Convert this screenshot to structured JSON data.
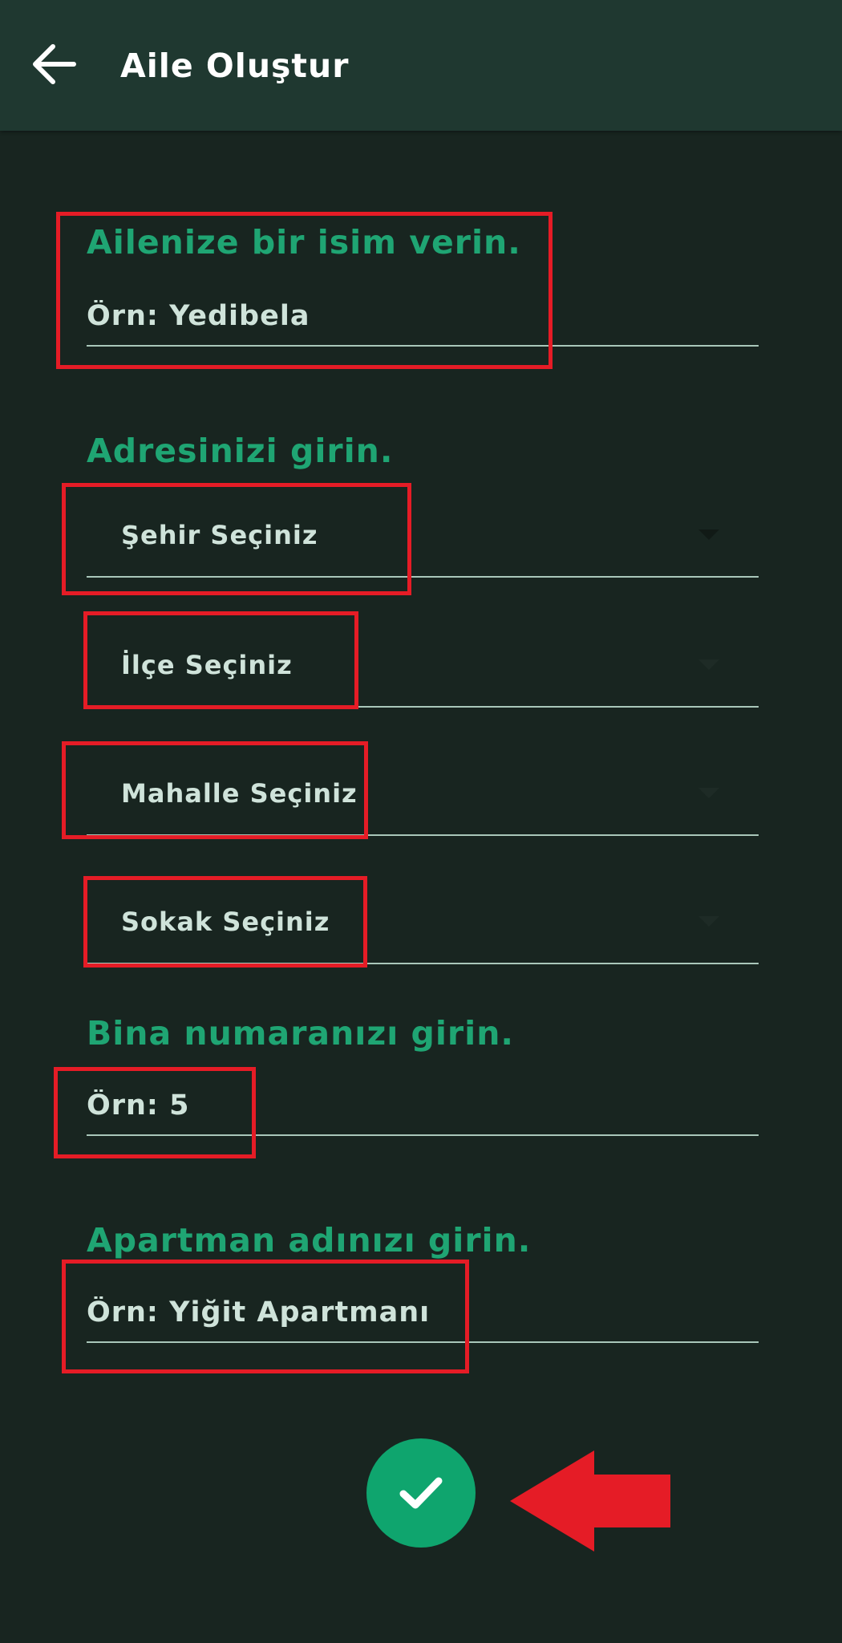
{
  "appbar": {
    "title": "Aile Oluştur"
  },
  "family_name": {
    "label": "Ailenize bir isim verin.",
    "placeholder": "Örn: Yedibela"
  },
  "address": {
    "label": "Adresinizi girin.",
    "city_select": "Şehir Seçiniz",
    "district_select": "İlçe Seçiniz",
    "neighborhood_select": "Mahalle Seçiniz",
    "street_select": "Sokak Seçiniz"
  },
  "building": {
    "label": "Bina numaranızı girin.",
    "placeholder": "Örn: 5"
  },
  "apartment": {
    "label": "Apartman adınızı girin.",
    "placeholder": "Örn: Yiğit Apartmanı"
  },
  "colors": {
    "background": "#182520",
    "appbar": "#1f3830",
    "accent_green": "#1fa573",
    "confirm_button": "#0fa56e",
    "highlight_red": "#e51c26"
  },
  "icons": {
    "back": "arrow-left-icon",
    "confirm": "checkmark-icon",
    "dropdown": "caret-down-icon",
    "annotation": "red-arrow-left-icon"
  }
}
